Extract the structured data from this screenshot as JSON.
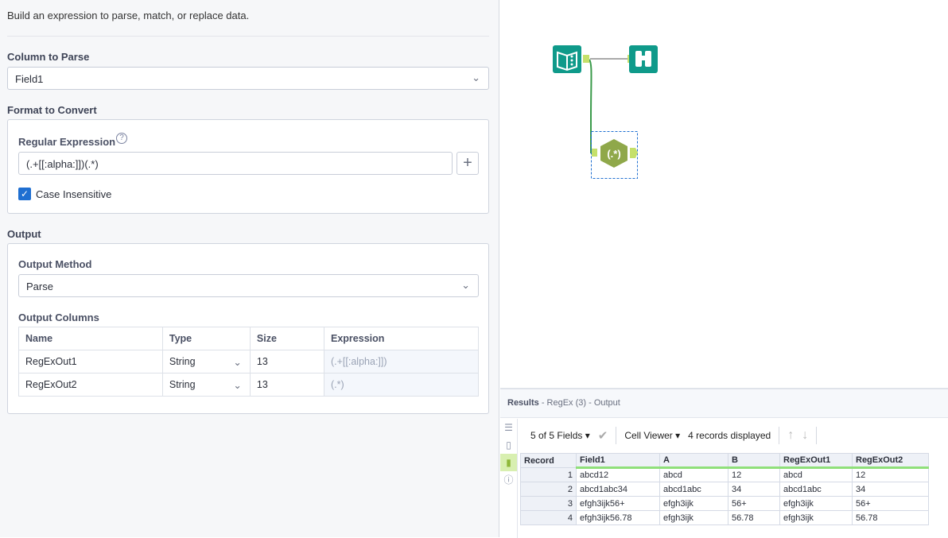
{
  "description": "Build an expression to parse, match, or replace data.",
  "column_to_parse": {
    "label": "Column to Parse",
    "value": "Field1"
  },
  "format": {
    "label": "Format to Convert",
    "regex_label": "Regular Expression",
    "regex_value": "(.+[[:alpha:]])(.*)",
    "case_insensitive_label": "Case Insensitive",
    "case_insensitive": true
  },
  "output": {
    "label": "Output",
    "method_label": "Output Method",
    "method_value": "Parse",
    "columns_label": "Output Columns",
    "headers": [
      "Name",
      "Type",
      "Size",
      "Expression"
    ],
    "rows": [
      {
        "name": "RegExOut1",
        "type": "String",
        "size": "13",
        "expr": "(.+[[:alpha:]])"
      },
      {
        "name": "RegExOut2",
        "type": "String",
        "size": "13",
        "expr": "(.*)"
      }
    ]
  },
  "results": {
    "title": "Results",
    "subtitle": "- RegEx (3) - Output",
    "fields": "5 of 5 Fields",
    "viewer": "Cell Viewer",
    "records": "4 records displayed",
    "headers": [
      "Record",
      "Field1",
      "A",
      "B",
      "RegExOut1",
      "RegExOut2"
    ],
    "rows": [
      [
        "1",
        "abcd12",
        "abcd",
        "12",
        "abcd",
        "12"
      ],
      [
        "2",
        "abcd1abc34",
        "abcd1abc",
        "34",
        "abcd1abc",
        "34"
      ],
      [
        "3",
        "efgh3ijk56+",
        "efgh3ijk",
        "56+",
        "efgh3ijk",
        "56+"
      ],
      [
        "4",
        "efgh3ijk56.78",
        "efgh3ijk",
        "56.78",
        "efgh3ijk",
        "56.78"
      ]
    ]
  },
  "colors": {
    "teal": "#0f9a8a",
    "regex": "#8fa84a",
    "anchor": "#c5e06a"
  }
}
